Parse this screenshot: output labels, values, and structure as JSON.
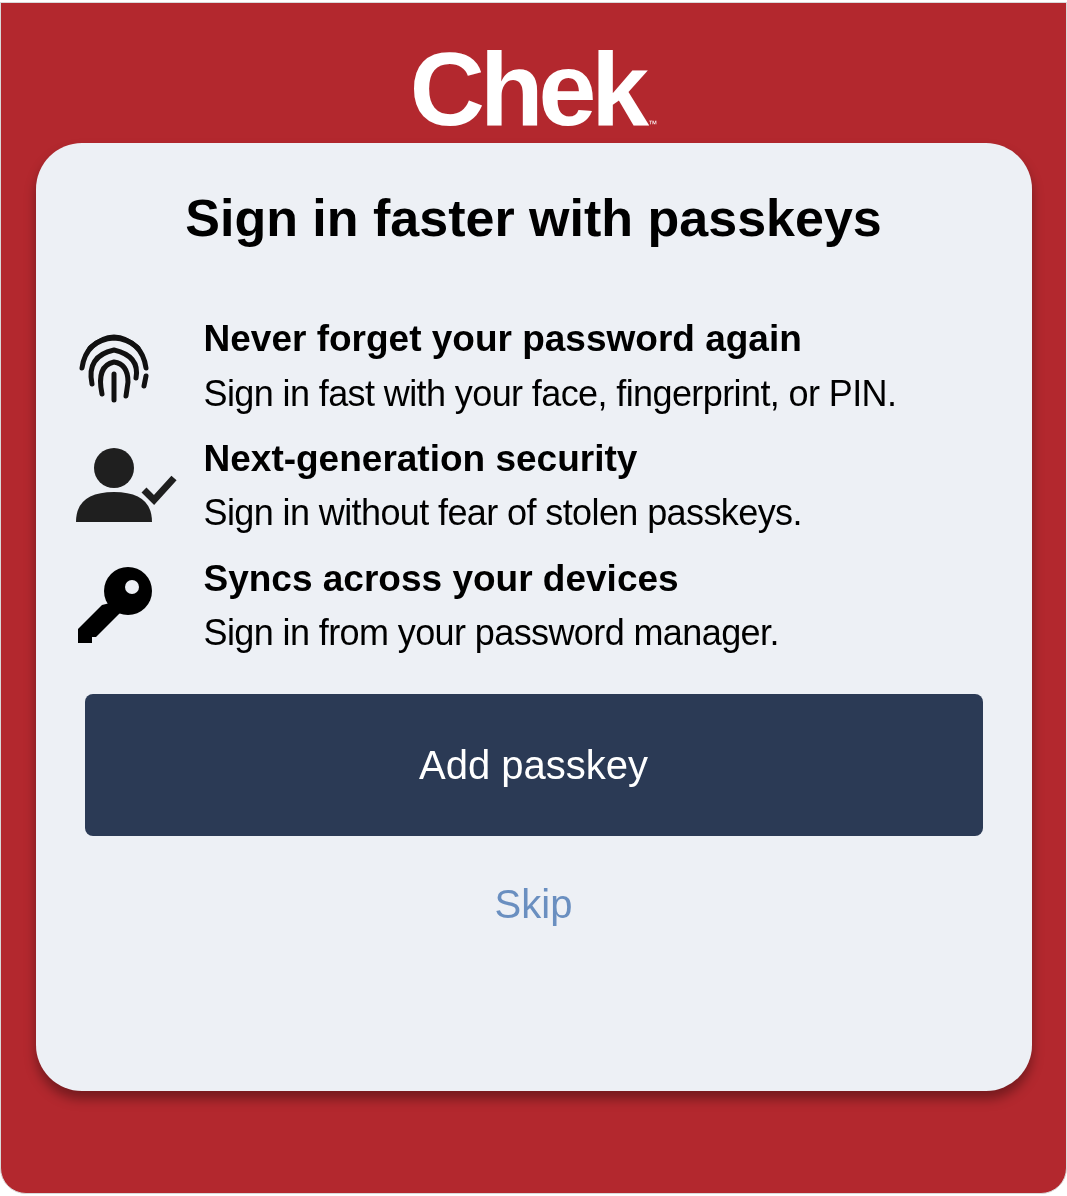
{
  "logo": {
    "text": "Chek",
    "mark": "™"
  },
  "dialog": {
    "title": "Sign in faster with passkeys",
    "features": [
      {
        "kind": "fingerprint",
        "heading": "Never forget your password again",
        "text": "Sign in fast with your face, fingerprint, or PIN."
      },
      {
        "kind": "person-check",
        "heading": "Next-generation security",
        "text": "Sign in without fear of stolen passkeys."
      },
      {
        "kind": "key",
        "heading": "Syncs across your devices",
        "text": "Sign in from your password manager."
      }
    ],
    "primary_button": "Add passkey",
    "skip_link": "Skip"
  }
}
